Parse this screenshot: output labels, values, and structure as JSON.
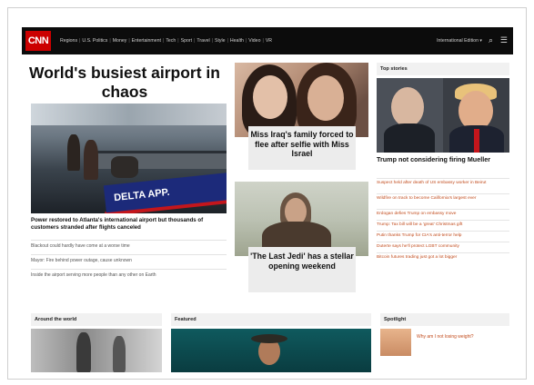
{
  "nav": {
    "logo": "CNN",
    "links": [
      "Regions",
      "U.S. Politics",
      "Money",
      "Entertainment",
      "Tech",
      "Sport",
      "Travel",
      "Style",
      "Health",
      "Video",
      "VR"
    ],
    "edition": "International Edition ▾",
    "search_icon": "⌕",
    "menu_icon": "☰"
  },
  "lead": {
    "headline": "World's busiest airport in chaos",
    "image_banner": "DELTA APP.",
    "caption": "Power restored to Atlanta's international airport but thousands of customers stranded after flights canceled",
    "related": [
      "Blackout could hardly have come at a worse time",
      "Mayor: Fire behind power outage, cause unknown",
      "Inside the airport serving more people than any other on Earth"
    ]
  },
  "middle": {
    "story1": "Miss Iraq's family forced to flee after selfie with Miss Israel",
    "story2": "'The Last Jedi' has a stellar opening weekend"
  },
  "top_stories": {
    "heading": "Top stories",
    "lead": "Trump not considering firing Mueller",
    "items": [
      "Suspect held after death of US embassy worker in Beirut",
      "Wildfire on track to become California's largest ever",
      "Erdogan defies Trump on embassy move",
      "Trump: Tax bill will be a 'great' Christmas gift",
      "Putin thanks Trump for CIA's anti-terror help",
      "Duterte says he'll protect LGBT community",
      "Bitcoin futures trading just got a lot bigger"
    ]
  },
  "sections": {
    "world": "Around the world",
    "featured": "Featured",
    "spotlight": "Spotlight",
    "spotlight_item": "Why am I not losing weight?"
  },
  "colors": {
    "brand_red": "#cc0000",
    "nav_bg": "#0c0c0c",
    "link_orange": "#c24b1c"
  }
}
